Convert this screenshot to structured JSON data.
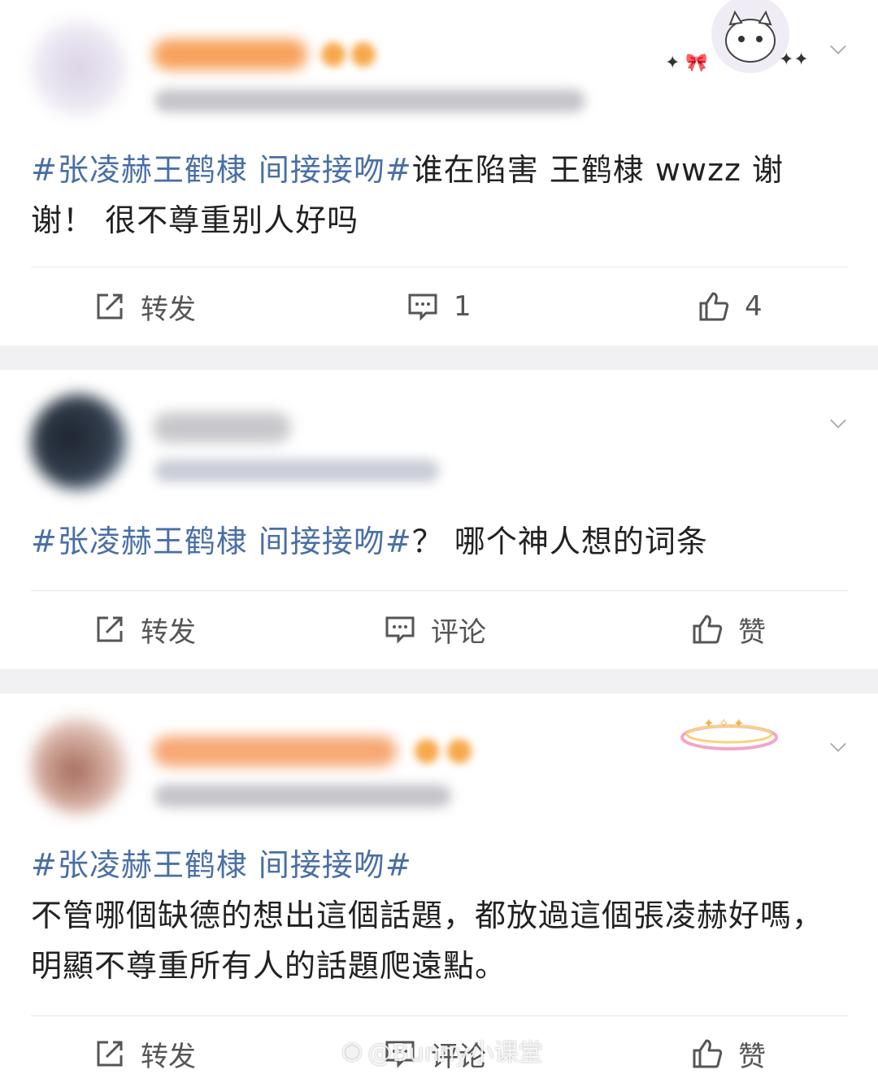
{
  "posts": [
    {
      "content_tag": "#张凌赫王鹤棣 间接接吻#",
      "content_text": "谁在陷害 王鹤棣 wwzz 谢谢！ 很不尊重别人好吗",
      "actions": {
        "repost": "转发",
        "comment": "1",
        "like": "4"
      }
    },
    {
      "content_tag": "#张凌赫王鹤棣 间接接吻#",
      "content_text": "？ 哪个神人想的词条",
      "actions": {
        "repost": "转发",
        "comment": "评论",
        "like": "赞"
      }
    },
    {
      "content_tag": "#张凌赫王鹤棣 间接接吻#",
      "content_text": "不管哪個缺德的想出這個話題，都放過這個張凌赫好嗎，明顯不尊重所有人的話題爬遠點。",
      "actions": {
        "repost": "转发",
        "comment": "评论",
        "like": "赞"
      }
    }
  ],
  "watermark": "@Bunny小课堂",
  "icons": {
    "repost": "repost-icon",
    "comment": "comment-icon",
    "like": "thumbs-up-icon",
    "more": "chevron-down-icon"
  },
  "colors": {
    "topic_link": "#4a6fa5",
    "background_gap": "#f1f1f3",
    "vip_name": "#f7a84a"
  }
}
